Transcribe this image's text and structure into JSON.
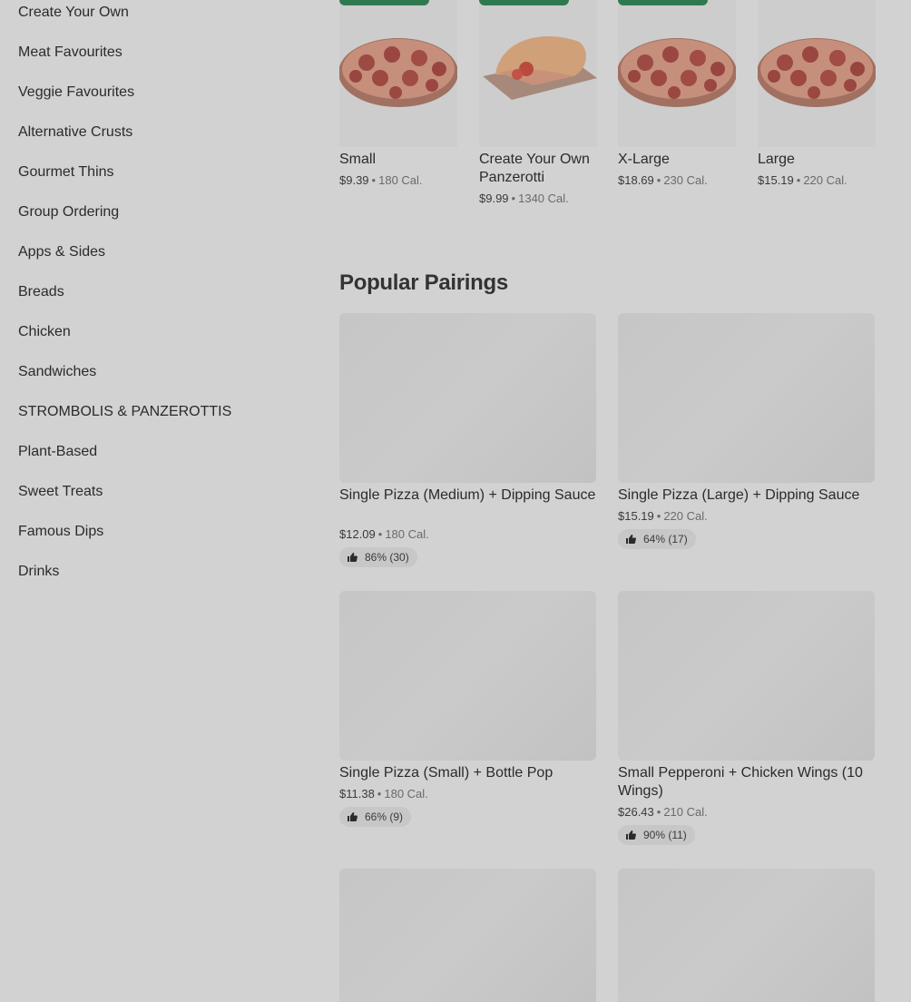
{
  "sidebar": {
    "items": [
      "Create Your Own",
      "Meat Favourites",
      "Veggie Favourites",
      "Alternative Crusts",
      "Gourmet Thins",
      "Group Ordering",
      "Apps & Sides",
      "Breads",
      "Chicken",
      "Sandwiches",
      "STROMBOLIS & PANZEROTTIS",
      "Plant-Based",
      "Sweet Treats",
      "Famous Dips",
      "Drinks"
    ]
  },
  "products": [
    {
      "name": "Small",
      "price": "$9.39",
      "cal": "180 Cal.",
      "image": "pizza"
    },
    {
      "name": "Create Your Own Panzerotti",
      "price": "$9.99",
      "cal": "1340 Cal.",
      "image": "panzerotti"
    },
    {
      "name": "X-Large",
      "price": "$18.69",
      "cal": "230 Cal.",
      "image": "pizza"
    },
    {
      "name": "Large",
      "price": "$15.19",
      "cal": "220 Cal.",
      "image": "pizza"
    }
  ],
  "popular_pairings": {
    "title": "Popular Pairings",
    "items": [
      {
        "name": "Single Pizza (Medium) + Dipping Sauce",
        "price": "$12.09",
        "cal": "180 Cal.",
        "rating": "86% (30)"
      },
      {
        "name": "Single Pizza (Large) + Dipping Sauce",
        "price": "$15.19",
        "cal": "220 Cal.",
        "rating": "64% (17)"
      },
      {
        "name": "Single Pizza (Small) + Bottle Pop",
        "price": "$11.38",
        "cal": "180 Cal.",
        "rating": "66% (9)"
      },
      {
        "name": "Small Pepperoni + Chicken Wings (10 Wings)",
        "price": "$26.43",
        "cal": "210 Cal.",
        "rating": "90% (11)"
      }
    ]
  },
  "colors": {
    "badge": "#2e7a4e",
    "overlay": "#d2d2d2"
  },
  "icons": {
    "rating": "thumbs-up-icon"
  },
  "separator": "•"
}
